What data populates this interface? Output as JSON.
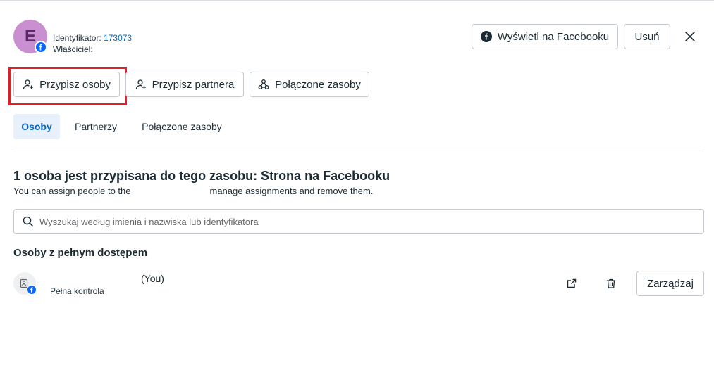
{
  "header": {
    "avatar_letter": "E",
    "id_label": "Identyfikator:",
    "id_value": "173073",
    "owner_label": "Właściciel:",
    "view_fb_label": "Wyświetl na Facebooku",
    "delete_label": "Usuń"
  },
  "actions": {
    "assign_people": "Przypisz osoby",
    "assign_partner": "Przypisz partnera",
    "connected_assets": "Połączone zasoby"
  },
  "tabs": [
    {
      "label": "Osoby",
      "active": true
    },
    {
      "label": "Partnerzy",
      "active": false
    },
    {
      "label": "Połączone zasoby",
      "active": false
    }
  ],
  "main": {
    "title": "1 osoba jest przypisana do tego zasobu: Strona na Facebooku",
    "subtitle_part1": "You can assign people to the",
    "subtitle_part2": "manage assignments and remove them.",
    "search_placeholder": "Wyszukaj według imienia i nazwiska lub identyfikatora",
    "section_heading": "Osoby z pełnym dostępem"
  },
  "person": {
    "you_label": "(You)",
    "role": "Pełna kontrola",
    "manage_label": "Zarządzaj"
  },
  "colors": {
    "accent": "#0a66c2",
    "facebook_blue": "#0866ff",
    "highlight_red": "#e31e24"
  }
}
